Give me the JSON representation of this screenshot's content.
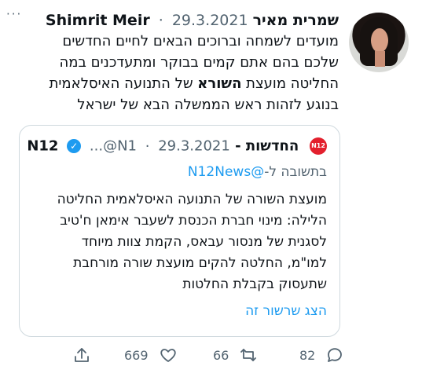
{
  "menu_icon_text": "···",
  "tweet": {
    "name_hebrew": "שמרית מאיר",
    "name_latin": "Shimrit Meir",
    "dot": "·",
    "date": "29.3.2021",
    "text_before_bold": "מועדים לשמחה וברוכים הבאים לחיים החדשים\nשלכם בהם אתם קמים בבוקר ומתעדכנים במה\nהחליטה מועצת ",
    "text_bold": "השורא",
    "text_after_bold": " של התנועה האיסלאמית\nבנוגע לזהות ראש הממשלה הבא של ישראל"
  },
  "quoted_tweet": {
    "logo": "N12",
    "name": "החדשות - N12",
    "handle": "...@N1",
    "dot": "·",
    "date": "29.3.2021",
    "reply_prefix": "בתשובה ל-",
    "reply_mention": "@N12News",
    "text": "מועצת השורה של התנועה האיסלאמית החליטה\nהלילה: מינוי חברת הכנסת לשעבר אימאן ח'טיב\nלסגנית של מנסור עבאס, הקמת צוות מיוחד\nלמו\"מ, החלטה להקים מועצת שורה מורחבת\nשתעסוק בקבלת החלטות",
    "show_thread": "הצג שרשור זה"
  },
  "actions": {
    "like_count": "669",
    "retweet_count": "66",
    "reply_count": "82",
    "icons": [
      "share-icon",
      "heart-icon",
      "retweet-icon",
      "reply-icon"
    ]
  },
  "colors": {
    "accent": "#1d9bf0",
    "secondary_text": "#536471",
    "border": "#cfd9de",
    "news_logo": "#e3202d"
  }
}
